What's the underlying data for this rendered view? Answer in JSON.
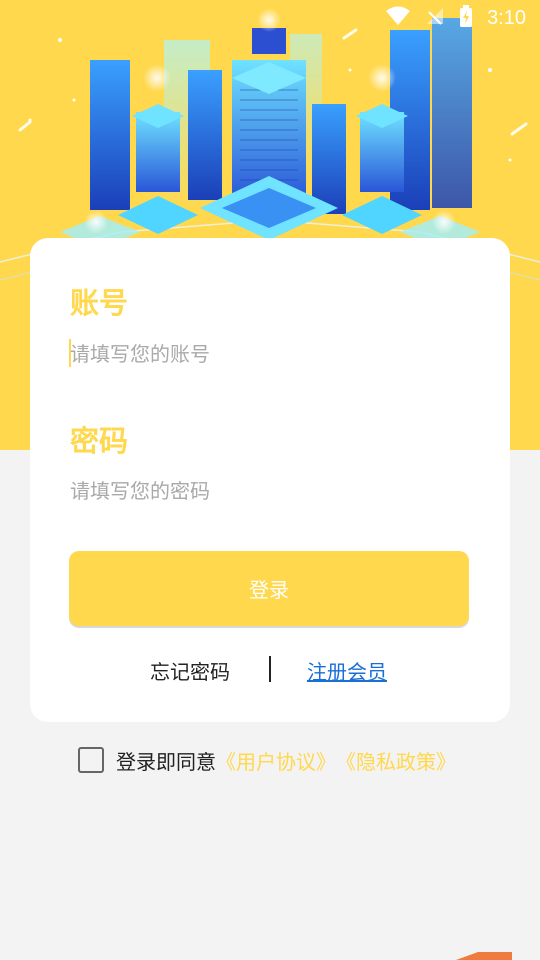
{
  "status_bar": {
    "time": "3:10",
    "icons": [
      "wifi-icon",
      "signal-off-icon",
      "battery-charging-icon"
    ]
  },
  "colors": {
    "accent": "#ffd84d",
    "link": "#1a6fd6",
    "background": "#f3f3f3"
  },
  "form": {
    "account_label": "账号",
    "account_placeholder": "请填写您的账号",
    "password_label": "密码",
    "password_placeholder": "请填写您的密码",
    "login_button": "登录",
    "forgot_password": "忘记密码",
    "register": "注册会员"
  },
  "agreement": {
    "prefix": "登录即同意",
    "user_agreement": "《用户协议》",
    "privacy_policy": "《隐私政策》",
    "checked": false
  }
}
